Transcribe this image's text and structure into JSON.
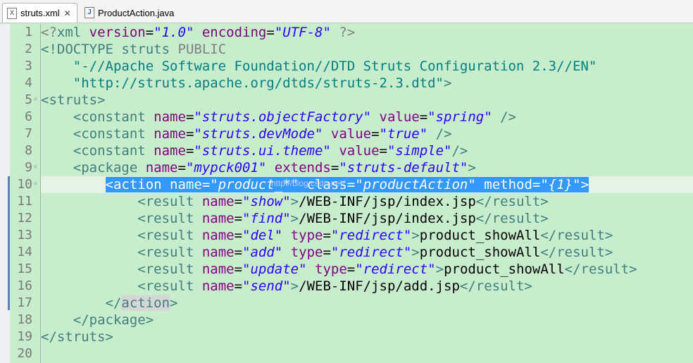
{
  "tabs": [
    {
      "label": "struts.xml",
      "icon": "xml-file-icon",
      "active": true
    },
    {
      "label": "ProductAction.java",
      "icon": "java-file-icon",
      "active": false
    }
  ],
  "line_numbers": [
    "1",
    "2",
    "3",
    "4",
    "5",
    "6",
    "7",
    "8",
    "9",
    "10",
    "11",
    "12",
    "13",
    "14",
    "15",
    "16",
    "17",
    "18",
    "19",
    "20"
  ],
  "code": {
    "l1": {
      "open": "<?",
      "tag": "xml",
      "a1": "version",
      "eq1": "=",
      "v1": "\"1.0\"",
      "a2": "encoding",
      "eq2": "=",
      "v2": "\"UTF-8\"",
      "close": "?>"
    },
    "l2": {
      "decl": "<!DOCTYPE",
      "name": "struts",
      "pub": "PUBLIC"
    },
    "l3": {
      "text": "\"-//Apache Software Foundation//DTD Struts Configuration 2.3//EN\""
    },
    "l4": {
      "text": "\"http://struts.apache.org/dtds/struts-2.3.dtd\"",
      "close": ">"
    },
    "l5": {
      "tag": "<struts>"
    },
    "l6": {
      "open": "<constant",
      "a1": "name",
      "v1": "\"struts.objectFactory\"",
      "a2": "value",
      "v2": "\"spring\"",
      "close": "/>"
    },
    "l7": {
      "open": "<constant",
      "a1": "name",
      "v1": "\"struts.devMode\"",
      "a2": "value",
      "v2": "\"true\"",
      "close": "/>"
    },
    "l8": {
      "open": "<constant",
      "a1": "name",
      "v1": "\"struts.ui.theme\"",
      "a2": "value",
      "v2": "\"simple\"",
      "close": "/>"
    },
    "l9": {
      "open": "<package",
      "a1": "name",
      "v1": "\"mypck001\"",
      "a2": "extends",
      "v2": "\"struts-default\"",
      "close": ">"
    },
    "l10": {
      "open": "<action",
      "a1": "name",
      "v1": "\"product_*\"",
      "a2": "class",
      "v2": "\"productAction\"",
      "a3": "method",
      "v3": "\"{1}\"",
      "close": ">"
    },
    "l11": {
      "open": "<result",
      "a1": "name",
      "v1": "\"show\"",
      "gt": ">",
      "body": "/WEB-INF/jsp/index.jsp",
      "end": "</result>"
    },
    "l12": {
      "open": "<result",
      "a1": "name",
      "v1": "\"find\"",
      "gt": ">",
      "body": "/WEB-INF/jsp/index.jsp",
      "end": "</result>"
    },
    "l13": {
      "open": "<result",
      "a1": "name",
      "v1": "\"del\"",
      "a2": "type",
      "v2": "\"redirect\"",
      "gt": ">",
      "body": "product_showAll",
      "end": "</result>"
    },
    "l14": {
      "open": "<result",
      "a1": "name",
      "v1": "\"add\"",
      "a2": "type",
      "v2": "\"redirect\"",
      "gt": ">",
      "body": "product_showAll",
      "end": "</result>"
    },
    "l15": {
      "open": "<result",
      "a1": "name",
      "v1": "\"update\"",
      "a2": "type",
      "v2": "\"redirect\"",
      "gt": ">",
      "body": "product_showAll",
      "end": "</result>"
    },
    "l16": {
      "open": "<result",
      "a1": "name",
      "v1": "\"send\"",
      "gt": ">",
      "body": "/WEB-INF/jsp/add.jsp",
      "end": "</result>"
    },
    "l17": {
      "pre": "</",
      "tag": "action",
      "close": ">"
    },
    "l18": {
      "tag": "</package>"
    },
    "l19": {
      "tag": "</struts>"
    }
  },
  "watermark": "http://blog.csdn.net/"
}
